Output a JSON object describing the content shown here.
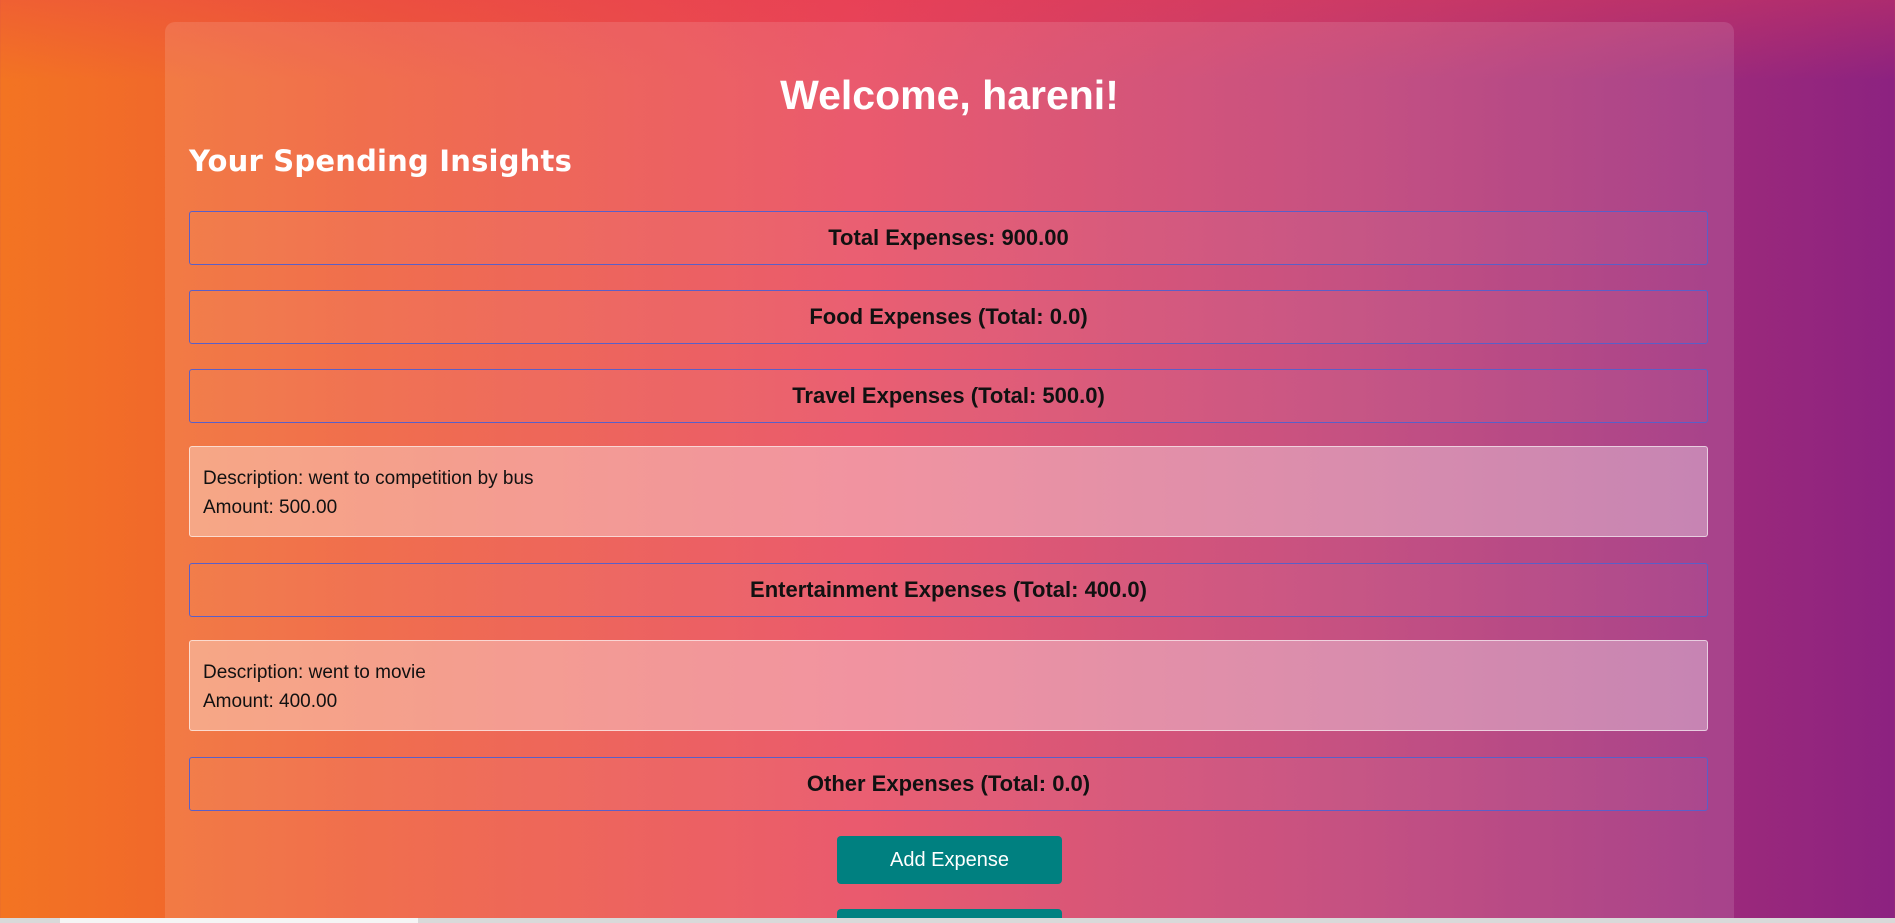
{
  "page": {
    "welcome_title": "Welcome, hareni!",
    "insights_title": "Your Spending Insights"
  },
  "sections": {
    "total": {
      "label": "Total Expenses: 900.00"
    },
    "food": {
      "label": "Food Expenses (Total: 0.0)"
    },
    "travel": {
      "label": "Travel Expenses (Total: 500.0)",
      "items": [
        {
          "description": "Description: went to competition by bus",
          "amount": "Amount: 500.00"
        }
      ]
    },
    "entertainment": {
      "label": "Entertainment Expenses (Total: 400.0)",
      "items": [
        {
          "description": "Description: went to movie",
          "amount": "Amount: 400.00"
        }
      ]
    },
    "other": {
      "label": "Other Expenses (Total: 0.0)"
    }
  },
  "actions": {
    "add_expense_label": "Add Expense",
    "second_button_label": ""
  },
  "colors": {
    "button": "#008080",
    "header_border": "#5b5fc7",
    "gradient_start": "#f37422",
    "gradient_end": "#8c2280"
  }
}
